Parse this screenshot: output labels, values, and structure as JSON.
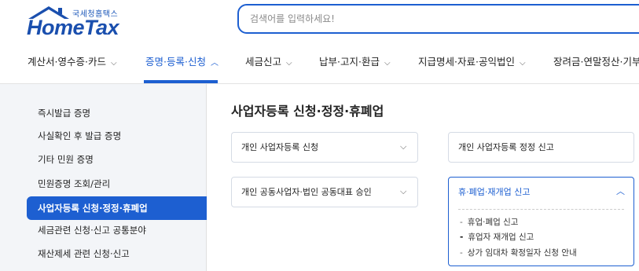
{
  "header": {
    "logo_sub": "국세청홈택스",
    "logo_main": "HomeTax",
    "search_placeholder": "검색어를 입력하세요!"
  },
  "gnb": [
    {
      "label": "계산서·영수증·카드",
      "active": false
    },
    {
      "label": "증명·등록·신청",
      "active": true
    },
    {
      "label": "세금신고",
      "active": false
    },
    {
      "label": "납부·고지·환급",
      "active": false
    },
    {
      "label": "지급명세·자료·공익법인",
      "active": false
    },
    {
      "label": "장려금·연말정산·기부",
      "active": false
    }
  ],
  "lnb": [
    {
      "label": "즉시발급 증명",
      "active": false
    },
    {
      "label": "사실확인 후 발급 증명",
      "active": false
    },
    {
      "label": "기타 민원 증명",
      "active": false
    },
    {
      "label": "민원증명 조회/관리",
      "active": false
    },
    {
      "label": "사업자등록 신청·정정·휴폐업",
      "active": true
    },
    {
      "label": "세금관련 신청·신고 공통분야",
      "active": false
    },
    {
      "label": "재산제세 관련 신청·신고",
      "active": false
    }
  ],
  "content": {
    "title": "사업자등록 신청·정정·휴폐업",
    "cards": [
      {
        "label": "개인 사업자등록 신청",
        "has_chevron": true,
        "open": false
      },
      {
        "label": "개인 사업자등록 정정 신고",
        "has_chevron": false,
        "open": false
      },
      {
        "label": "개인 공동사업자·법인 공동대표 승인",
        "has_chevron": true,
        "open": false
      },
      {
        "label": "휴·폐업·재개업 신고",
        "has_chevron": true,
        "open": true,
        "sub_items": [
          "휴업·폐업 신고",
          "휴업자 재개업 신고",
          "상가 임대차 확정일자 신청 안내"
        ]
      }
    ]
  },
  "colors": {
    "accent": "#1d5fd1",
    "lnb_bg": "#f3f5f8",
    "logo": "#1a4fae"
  }
}
